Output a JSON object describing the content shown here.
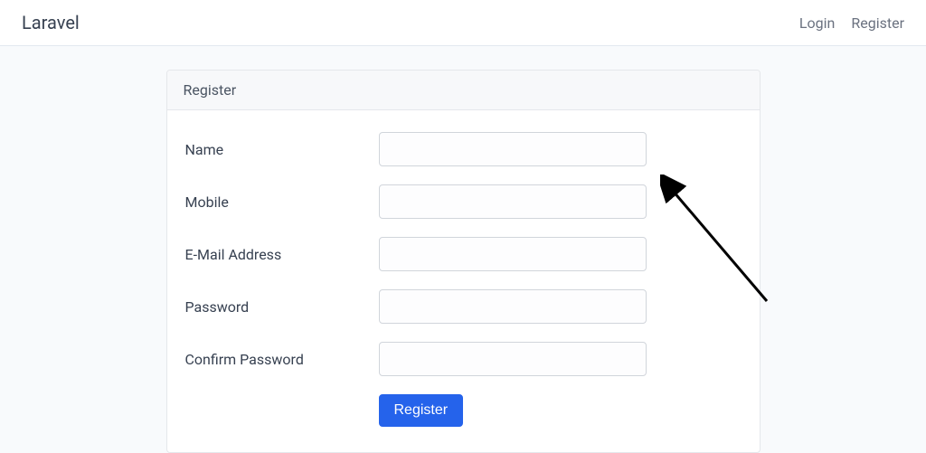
{
  "navbar": {
    "brand": "Laravel",
    "login_label": "Login",
    "register_label": "Register"
  },
  "card": {
    "header": "Register"
  },
  "form": {
    "name_label": "Name",
    "name_value": "",
    "mobile_label": "Mobile",
    "mobile_value": "",
    "email_label": "E-Mail Address",
    "email_value": "",
    "password_label": "Password",
    "password_value": "",
    "confirm_label": "Confirm Password",
    "confirm_value": "",
    "submit_label": "Register"
  }
}
